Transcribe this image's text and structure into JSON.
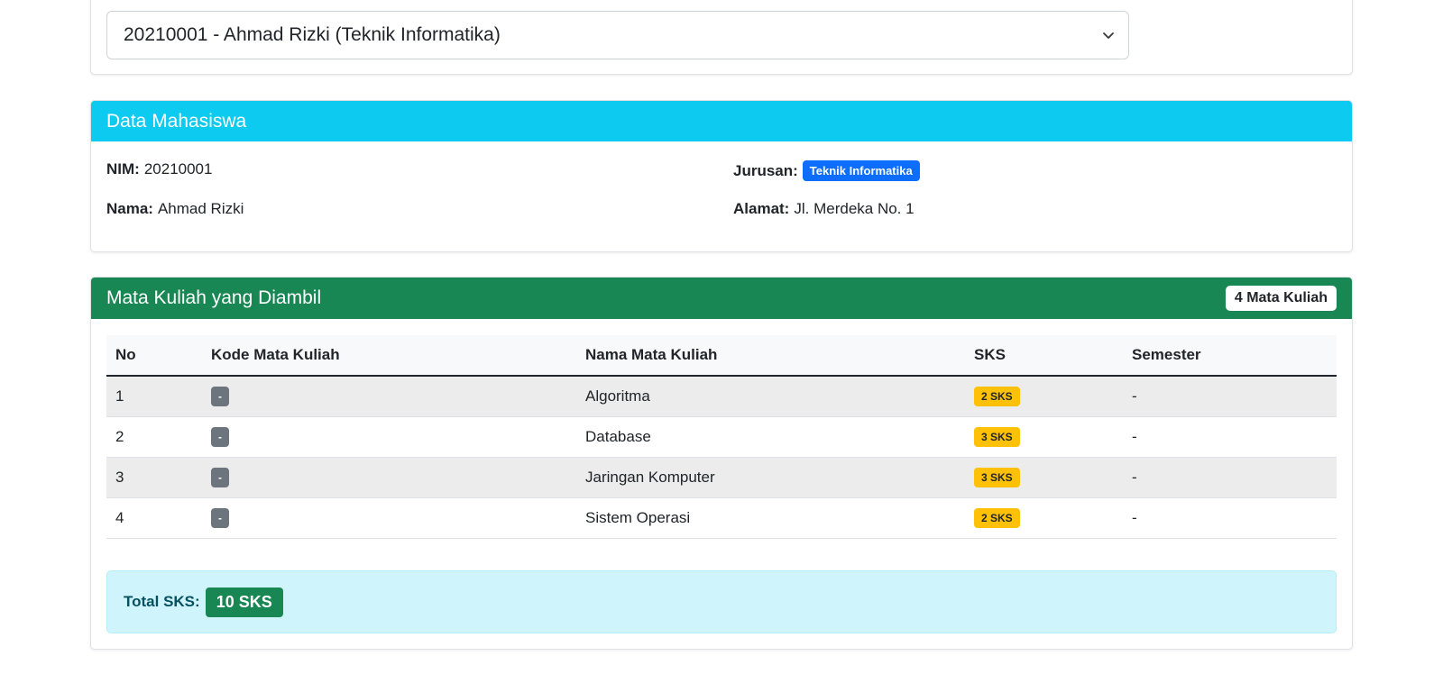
{
  "student_select": {
    "selected": "20210001 - Ahmad Rizki (Teknik Informatika)",
    "icon": "chevron-down-icon"
  },
  "student_card": {
    "title": "Data Mahasiswa",
    "nim_label": "NIM:",
    "nim": "20210001",
    "nama_label": "Nama:",
    "nama": "Ahmad Rizki",
    "jurusan_label": "Jurusan:",
    "jurusan": "Teknik Informatika",
    "alamat_label": "Alamat:",
    "alamat": "Jl. Merdeka No. 1"
  },
  "courses_card": {
    "title": "Mata Kuliah yang Diambil",
    "count_badge": "4 Mata Kuliah",
    "columns": [
      "No",
      "Kode Mata Kuliah",
      "Nama Mata Kuliah",
      "SKS",
      "Semester"
    ],
    "rows": [
      {
        "no": "1",
        "kode": "-",
        "nama": "Algoritma",
        "sks": "2 SKS",
        "semester": "-"
      },
      {
        "no": "2",
        "kode": "-",
        "nama": "Database",
        "sks": "3 SKS",
        "semester": "-"
      },
      {
        "no": "3",
        "kode": "-",
        "nama": "Jaringan Komputer",
        "sks": "3 SKS",
        "semester": "-"
      },
      {
        "no": "4",
        "kode": "-",
        "nama": "Sistem Operasi",
        "sks": "2 SKS",
        "semester": "-"
      }
    ],
    "total_label": "Total SKS:",
    "total_value": "10 SKS"
  },
  "colors": {
    "info": "#0dcaf0",
    "success": "#198754",
    "primary": "#0d6efd",
    "warning": "#ffc107",
    "secondary": "#6c757d"
  }
}
